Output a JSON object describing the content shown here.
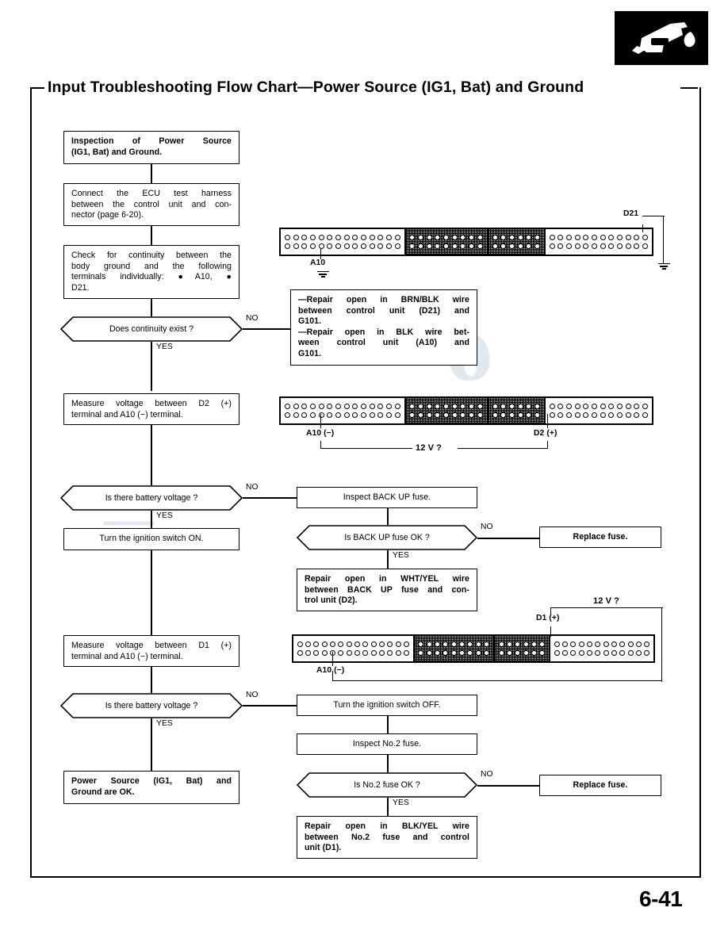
{
  "page": {
    "number": "6-41",
    "title": "Input Troubleshooting Flow Chart—Power Source (IG1, Bat) and Ground",
    "icon": "fuel-nozzle-icon"
  },
  "flow": {
    "step_inspection": {
      "line1": "Inspection of Power Source",
      "line2": "(IG1, Bat) and Ground."
    },
    "step_connect_harness": {
      "line1": "Connect the ECU test harness",
      "line2": "between the control unit and con-",
      "line3": "nector (page 6-20)."
    },
    "step_check_continuity": {
      "line1": "Check for continuity between the",
      "line2": "body ground and the following",
      "line3": "terminals individually: ●A10, ●",
      "line4": "D21."
    },
    "decision_continuity": "Does continuity exist ?",
    "repair_ground": {
      "line1": "—Repair open in BRN/BLK wire",
      "line2": "between control unit (D21) and",
      "line3": "G101.",
      "line4": "—Repair open in BLK wire bet-",
      "line5": "ween control unit (A10) and",
      "line6": "G101."
    },
    "step_measure_d2": {
      "line1": "Measure voltage between D2 (+)",
      "line2": "terminal and A10 (−) terminal."
    },
    "decision_battery_voltage_1": "Is there battery voltage ?",
    "step_ignition_on": "Turn the ignition switch ON.",
    "step_inspect_backup_fuse": "Inspect BACK UP fuse.",
    "decision_backup_fuse": "Is BACK UP fuse OK ?",
    "replace_fuse_1": "Replace fuse.",
    "repair_whtyel": {
      "line1": "Repair open in WHT/YEL wire",
      "line2": "between BACK UP fuse and con-",
      "line3": "trol unit (D2)."
    },
    "step_measure_d1": {
      "line1": "Measure voltage between D1 (+)",
      "line2": "terminal and A10 (−) terminal."
    },
    "decision_battery_voltage_2": "Is there battery voltage ?",
    "step_ignition_off": "Turn the ignition switch OFF.",
    "step_inspect_no2_fuse": "Inspect No.2 fuse.",
    "decision_no2_fuse": "Is No.2 fuse OK ?",
    "replace_fuse_2": "Replace fuse.",
    "repair_blkyel": {
      "line1": "Repair open in BLK/YEL wire",
      "line2": "between No.2 fuse and control",
      "line3": "unit (D1)."
    },
    "result_ok": {
      "line1": "Power Source (IG1, Bat) and",
      "line2": "Ground are OK."
    },
    "branch_labels": {
      "no": "NO",
      "yes": "YES"
    }
  },
  "connectors": {
    "segments": [
      14,
      9,
      6,
      12
    ],
    "shaded_segments": [
      1,
      2
    ],
    "diagram_1": {
      "label_left": "A10",
      "label_right": "D21",
      "ground_left": "ground-symbol",
      "ground_right": "ground-symbol"
    },
    "diagram_2": {
      "label_left": "A10 (−)",
      "label_right": "D2 (+)",
      "measurement": "12 V ?"
    },
    "diagram_3": {
      "label_left": "A10 (−)",
      "label_right": "D1 (+)",
      "measurement": "12 V ?"
    }
  }
}
